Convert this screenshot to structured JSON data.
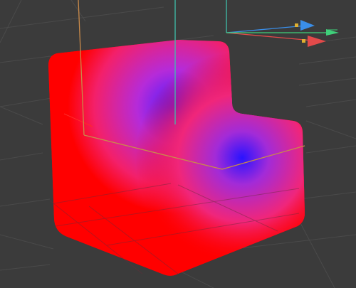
{
  "viewport": {
    "background": "#3b3b3b",
    "grid_color": "#4a4a4a"
  },
  "object": {
    "material": "radial-gradient",
    "base_color": "#ff0000",
    "highlight_color": "#5a1cff"
  },
  "bounding_box": {
    "color": "#c98a4a",
    "secondary_color": "#3fbfaa"
  },
  "gizmo": {
    "x_axis_color": "#e24a4a",
    "y_axis_color": "#3a8ee8",
    "z_axis_color": "#3fd07a",
    "icons": [
      "move-x-arrow-icon",
      "move-y-arrow-icon",
      "move-z-arrow-icon"
    ]
  }
}
